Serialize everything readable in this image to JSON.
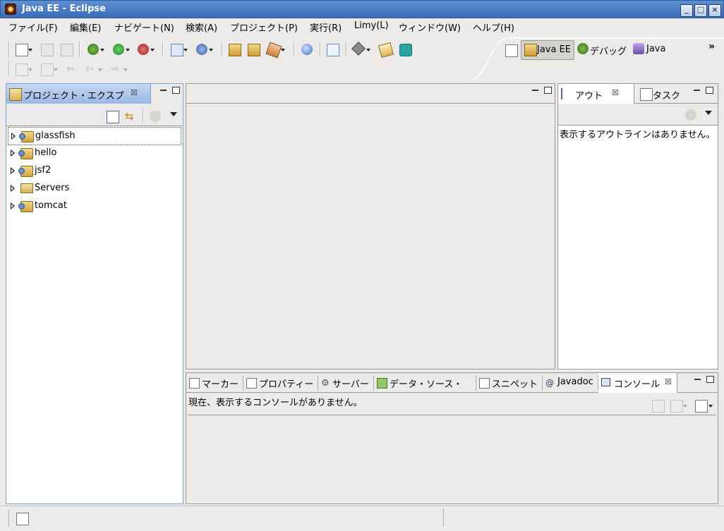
{
  "window": {
    "title": "Java EE - Eclipse",
    "buttons": [
      "_",
      "□",
      "×"
    ]
  },
  "menubar": [
    "ファイル(F)",
    "編集(E)",
    "ナビゲート(N)",
    "検索(A)",
    "プロジェクト(P)",
    "実行(R)",
    "Limy(L)",
    "ウィンドウ(W)",
    "ヘルプ(H)"
  ],
  "perspectives": {
    "active": "Java EE",
    "debug": "デバッグ",
    "java": "Java",
    "more": "»"
  },
  "project_explorer": {
    "title": "プロジェクト・エクスプ",
    "items": [
      {
        "label": "glassfish",
        "type": "project"
      },
      {
        "label": "hello",
        "type": "project"
      },
      {
        "label": "jsf2",
        "type": "project"
      },
      {
        "label": "Servers",
        "type": "folder"
      },
      {
        "label": "tomcat",
        "type": "project"
      }
    ]
  },
  "outline": {
    "tab1": "アウト",
    "tab2": "タスク",
    "message": "表示するアウトラインはありません。"
  },
  "bottom_panel": {
    "tabs": [
      "マーカー",
      "プロパティー",
      "サーバー",
      "データ・ソース・",
      "スニペット",
      "Javadoc",
      "コンソール"
    ],
    "message": "現在、表示するコンソールがありません。"
  }
}
